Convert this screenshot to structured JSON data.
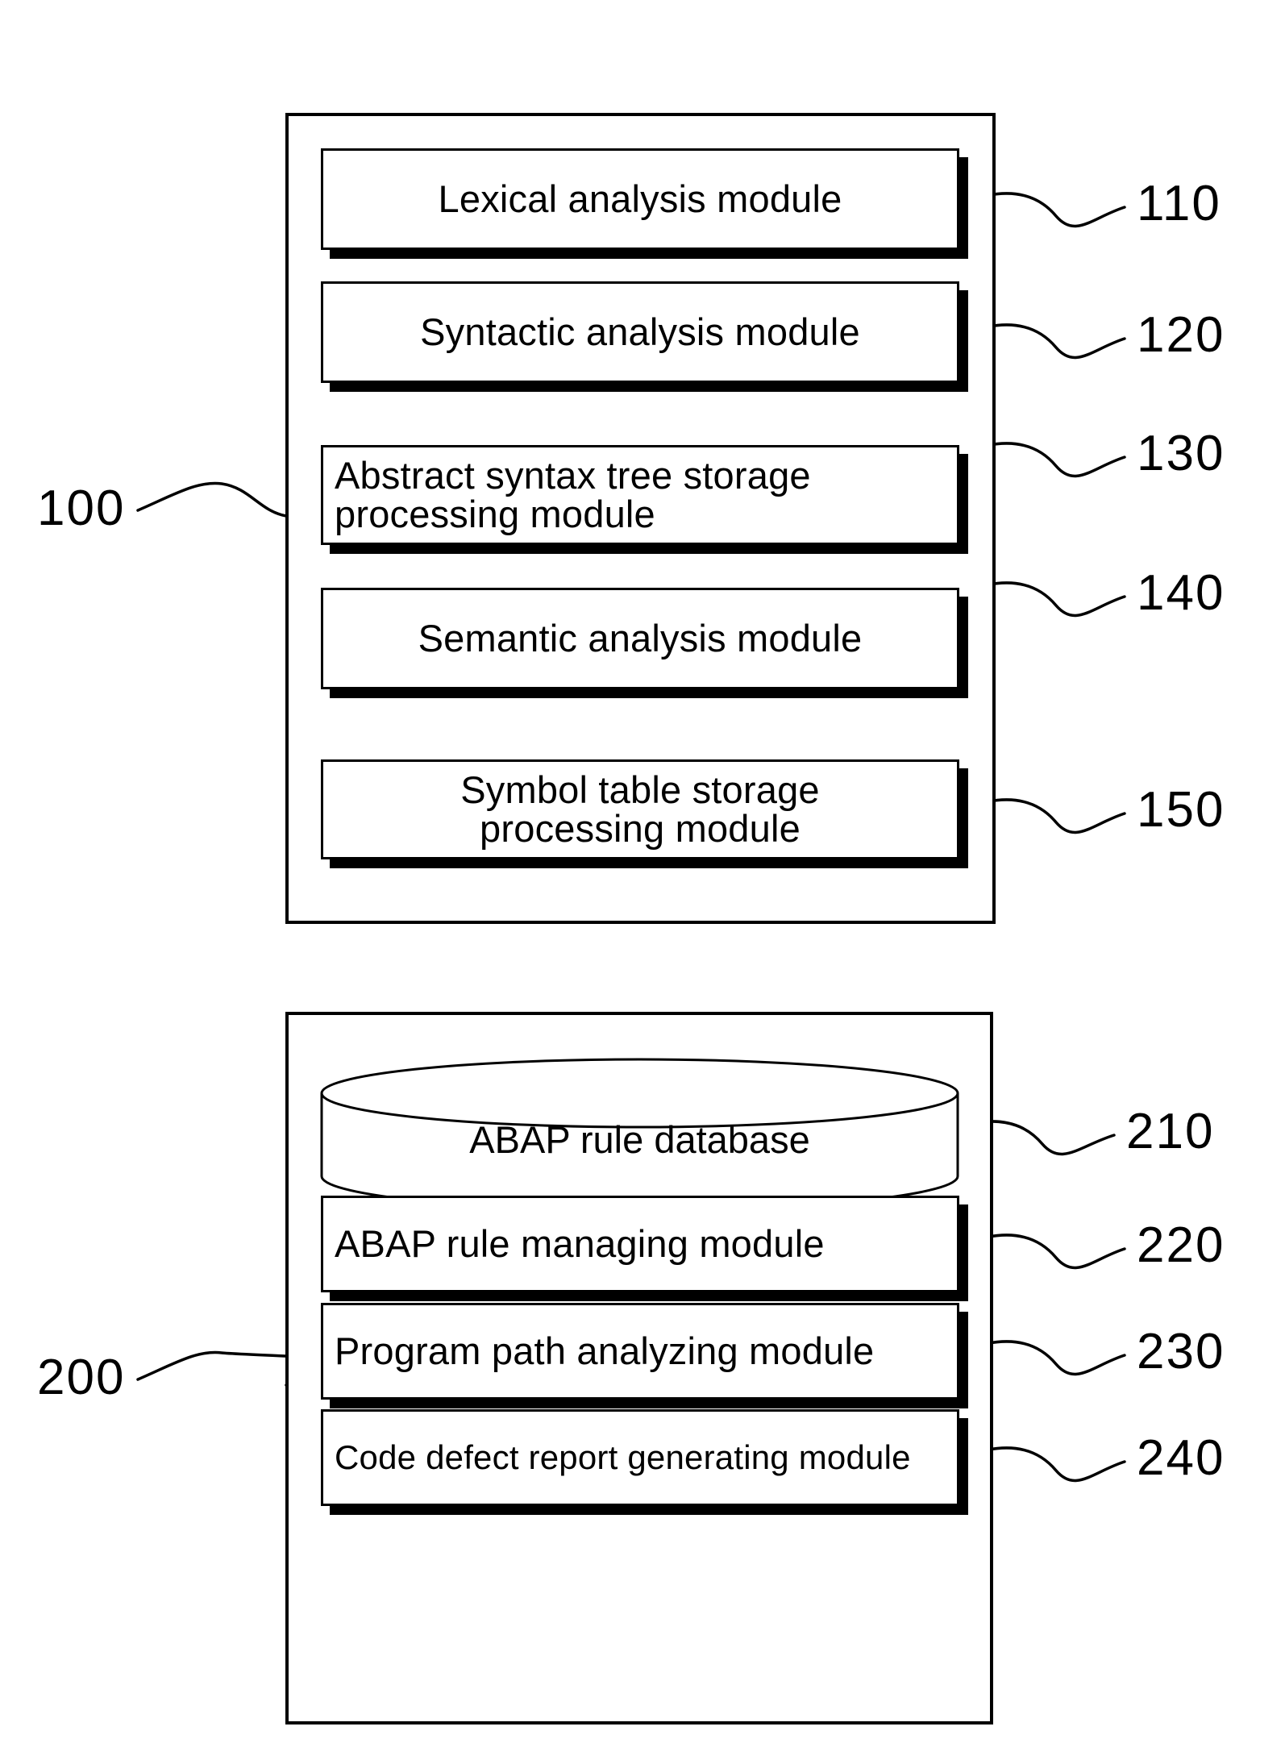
{
  "figure": {
    "groups": [
      {
        "id": "analysis-group",
        "ref": "100",
        "modules": [
          {
            "id": "lexical-analysis-module",
            "label": "Lexical analysis module",
            "ref": "110",
            "align": "center",
            "lines": 1
          },
          {
            "id": "syntactic-analysis-module",
            "label": "Syntactic analysis module",
            "ref": "120",
            "align": "center",
            "lines": 1
          },
          {
            "id": "ast-storage-processing-module",
            "label": "Abstract syntax tree storage\nprocessing module",
            "ref": "130",
            "align": "left",
            "lines": 2
          },
          {
            "id": "semantic-analysis-module",
            "label": "Semantic analysis module",
            "ref": "140",
            "align": "center",
            "lines": 1
          },
          {
            "id": "symbol-table-storage-processing-module",
            "label": "Symbol table storage\nprocessing module",
            "ref": "150",
            "align": "center",
            "lines": 2
          }
        ]
      },
      {
        "id": "rule-engine-group",
        "ref": "200",
        "modules": [
          {
            "id": "abap-rule-database",
            "label": "ABAP rule database",
            "ref": "210",
            "shape": "cylinder",
            "align": "center",
            "lines": 1
          },
          {
            "id": "abap-rule-managing-module",
            "label": "ABAP rule managing module",
            "ref": "220",
            "shape": "box",
            "align": "left",
            "lines": 1
          },
          {
            "id": "program-path-analyzing-module",
            "label": "Program path analyzing module",
            "ref": "230",
            "shape": "box",
            "align": "left",
            "lines": 1
          },
          {
            "id": "code-defect-report-generating-module",
            "label": "Code defect report generating module",
            "ref": "240",
            "shape": "box",
            "align": "left",
            "lines": 1
          }
        ]
      }
    ],
    "colors": {
      "line": "#000000",
      "fill": "#ffffff",
      "shadow": "#000000"
    }
  }
}
